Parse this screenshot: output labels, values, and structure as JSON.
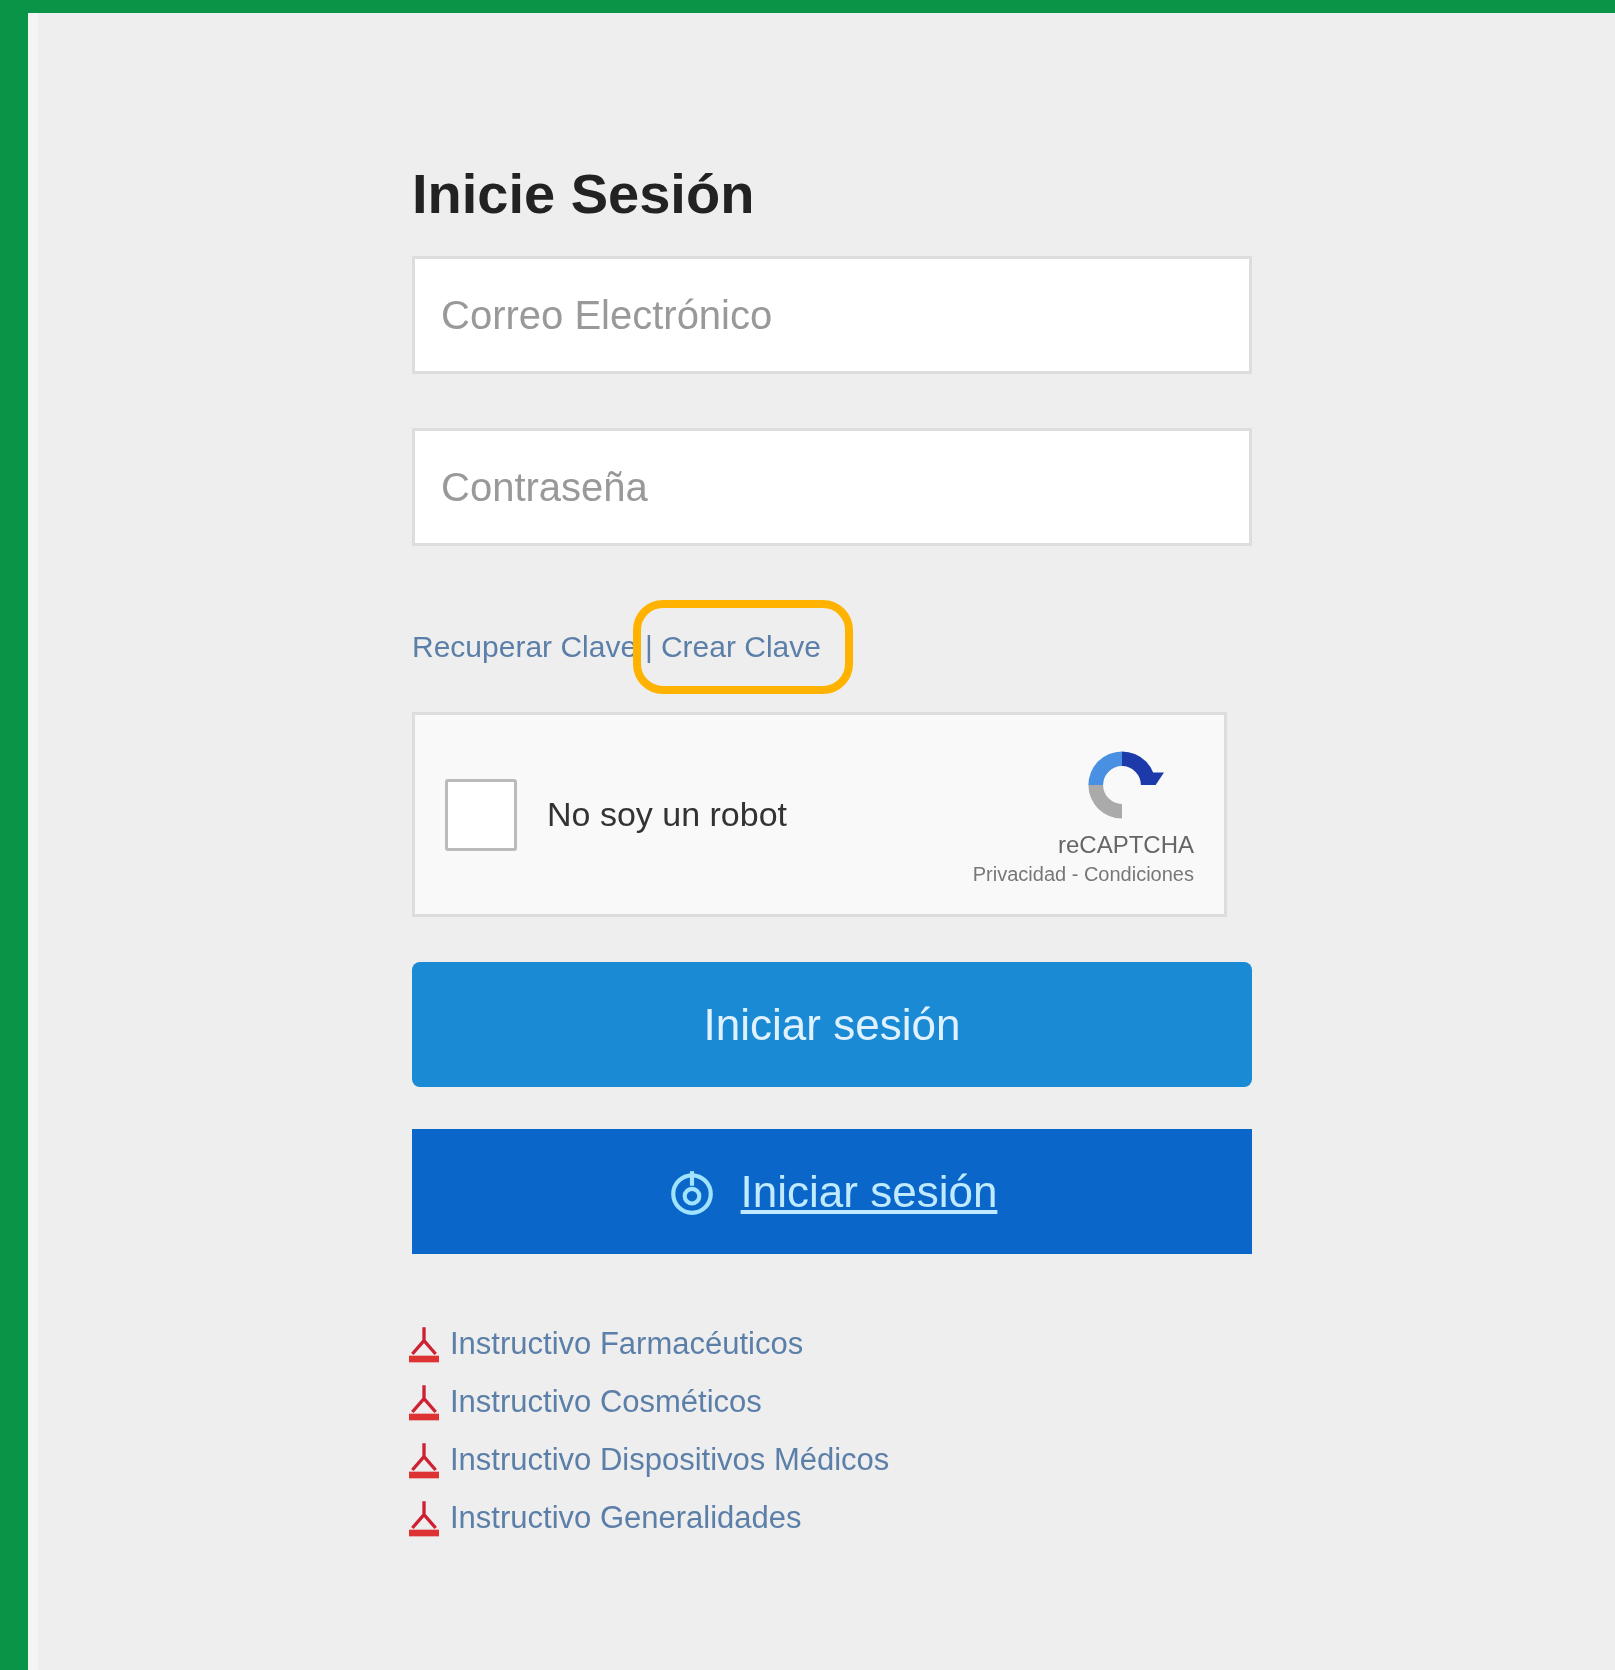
{
  "title": "Inicie Sesión",
  "fields": [
    {
      "placeholder": "Correo Electrónico"
    },
    {
      "placeholder": "Contraseña"
    }
  ],
  "account_links": [
    {
      "label": "Recuperar Clave",
      "highlighted": false
    },
    {
      "label": "Crear Clave",
      "highlighted": true
    }
  ],
  "separator": "|",
  "captcha": {
    "label": "No soy un robot",
    "checked": false,
    "brand": "reCAPTCHA",
    "terms": "Privacidad - Condiciones"
  },
  "buttons": [
    {
      "label": "Iniciar sesión",
      "kind": "primary"
    },
    {
      "label": "Iniciar sesión",
      "kind": "sso"
    }
  ],
  "documents": [
    "Instructivo Farmacéuticos",
    "Instructivo Cosméticos",
    "Instructivo Dispositivos Médicos",
    "Instructivo Generalidades"
  ]
}
